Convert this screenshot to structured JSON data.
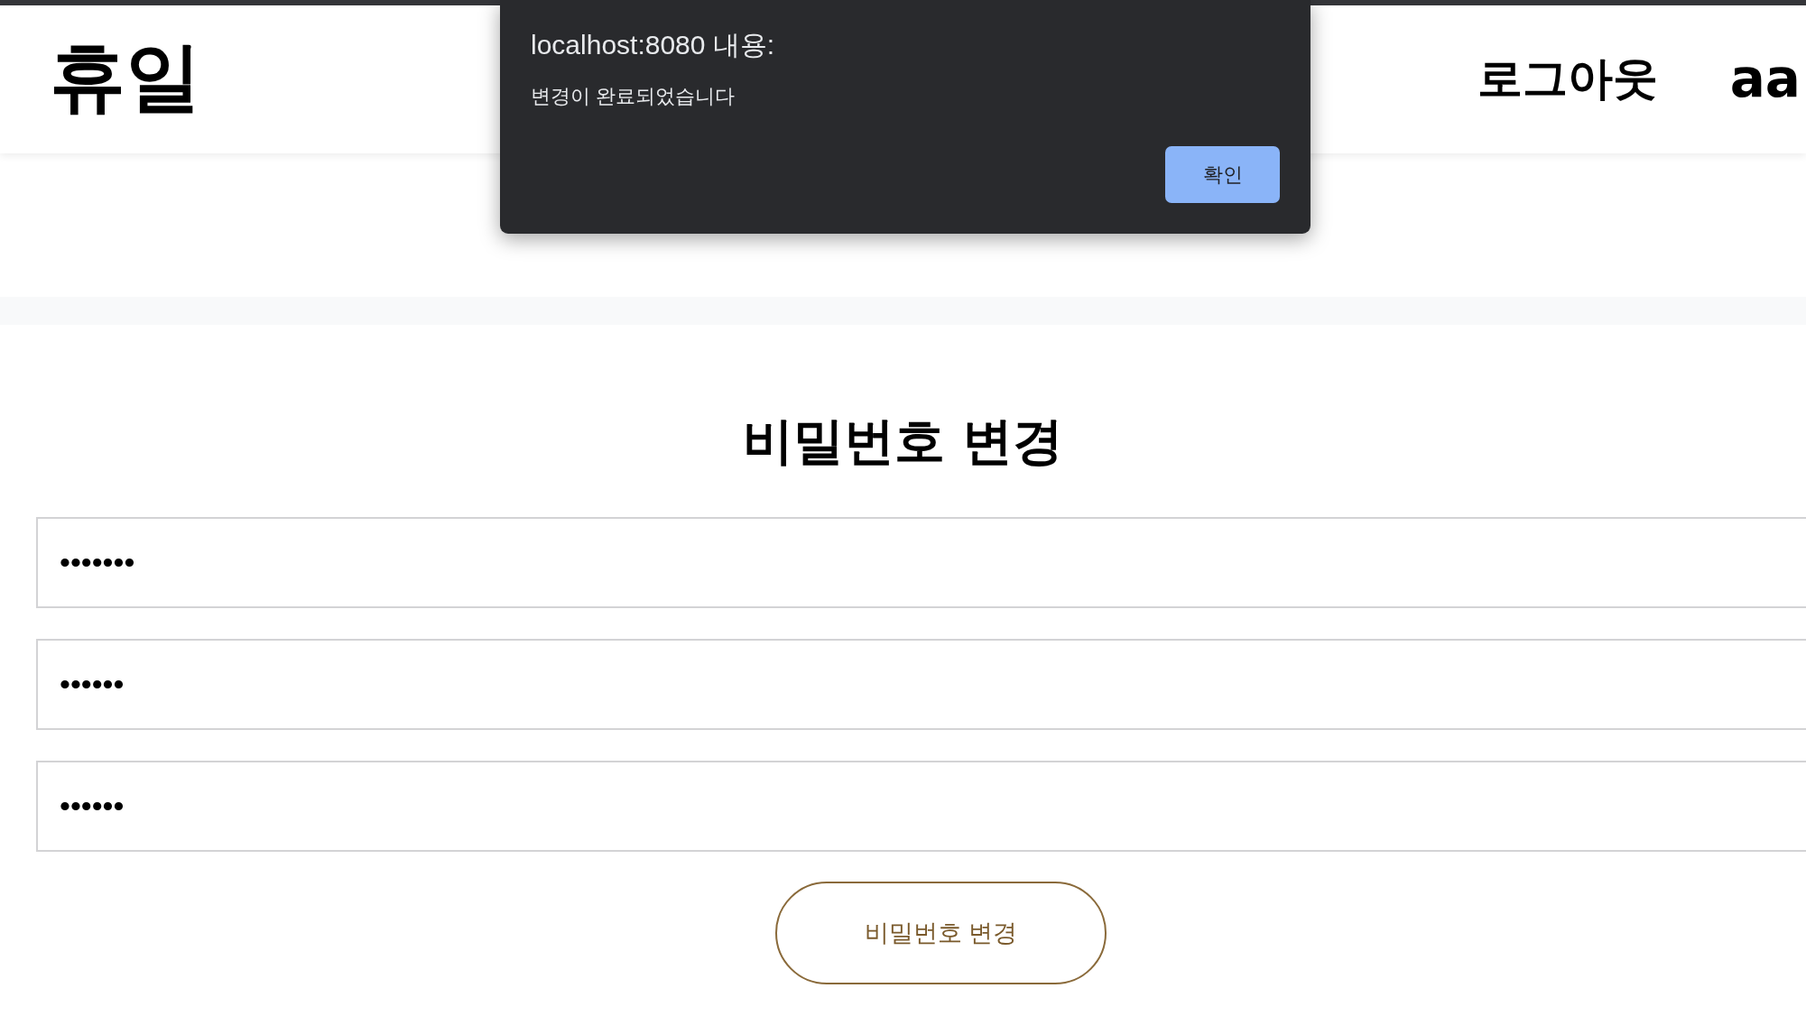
{
  "header": {
    "logo": "휴일",
    "nav": [
      {
        "kind": "link",
        "label": "로그아웃"
      },
      {
        "kind": "user",
        "label": "aa"
      }
    ]
  },
  "dialog": {
    "title": "localhost:8080 내용:",
    "message": "변경이 완료되었습니다",
    "buttons": [
      "확인"
    ]
  },
  "page": {
    "title": "비밀번호 변경",
    "fields": [
      {
        "value": "•••••••"
      },
      {
        "value": "••••••"
      },
      {
        "value": "••••••"
      }
    ],
    "submit_button": "비밀번호 변경"
  }
}
